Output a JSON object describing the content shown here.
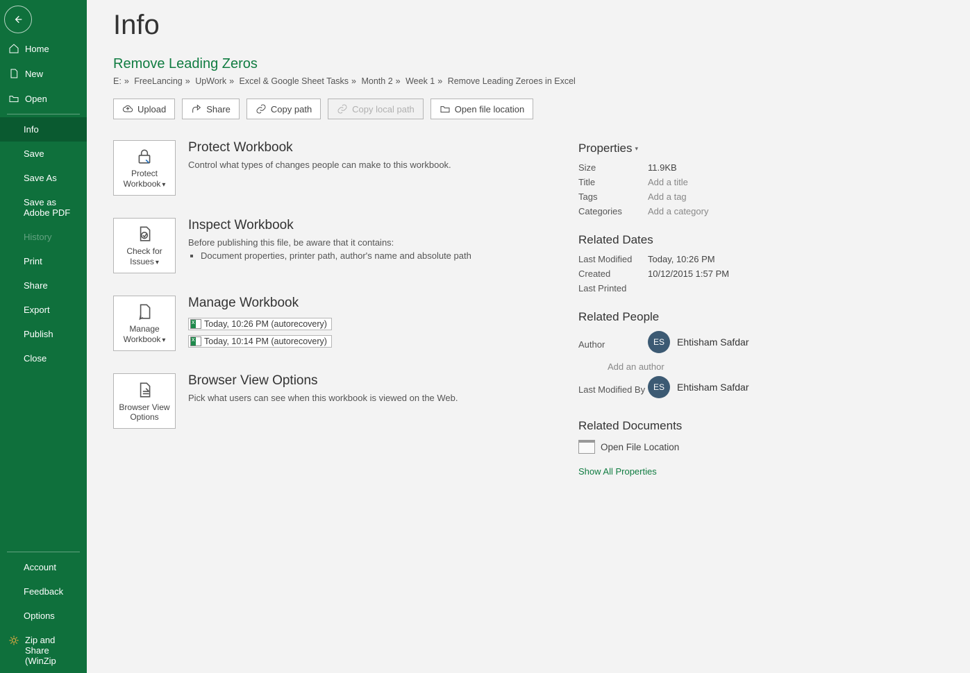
{
  "page": {
    "title": "Info"
  },
  "document": {
    "title": "Remove Leading Zeros"
  },
  "breadcrumb": {
    "parts": [
      "E:",
      "FreeLancing",
      "UpWork",
      "Excel & Google Sheet Tasks",
      "Month 2",
      "Week 1",
      "Remove Leading Zeroes in Excel"
    ],
    "sep": "»"
  },
  "sidebar": {
    "top": [
      {
        "key": "home",
        "label": "Home"
      },
      {
        "key": "new",
        "label": "New"
      },
      {
        "key": "open",
        "label": "Open"
      }
    ],
    "mid": [
      {
        "key": "info",
        "label": "Info",
        "selected": true
      },
      {
        "key": "save",
        "label": "Save"
      },
      {
        "key": "saveas",
        "label": "Save As"
      },
      {
        "key": "savepdf",
        "label": "Save as Adobe PDF"
      },
      {
        "key": "history",
        "label": "History",
        "disabled": true
      },
      {
        "key": "print",
        "label": "Print"
      },
      {
        "key": "share",
        "label": "Share"
      },
      {
        "key": "export",
        "label": "Export"
      },
      {
        "key": "publish",
        "label": "Publish"
      },
      {
        "key": "close",
        "label": "Close"
      }
    ],
    "bottom": [
      {
        "key": "account",
        "label": "Account"
      },
      {
        "key": "feedback",
        "label": "Feedback"
      },
      {
        "key": "options",
        "label": "Options"
      },
      {
        "key": "zip",
        "label": "Zip and Share (WinZip"
      }
    ]
  },
  "actions": {
    "upload": "Upload",
    "share": "Share",
    "copypath": "Copy path",
    "copylocal": "Copy local path",
    "openloc": "Open file location"
  },
  "blocks": {
    "protect": {
      "btn": "Protect Workbook",
      "title": "Protect Workbook",
      "desc": "Control what types of changes people can make to this workbook."
    },
    "inspect": {
      "btn": "Check for Issues",
      "title": "Inspect Workbook",
      "desc": "Before publishing this file, be aware that it contains:",
      "items": [
        "Document properties, printer path, author's name and absolute path"
      ]
    },
    "manage": {
      "btn": "Manage Workbook",
      "title": "Manage Workbook",
      "versions": [
        "Today, 10:26 PM (autorecovery)",
        "Today, 10:14 PM (autorecovery)"
      ]
    },
    "browser": {
      "btn": "Browser View Options",
      "title": "Browser View Options",
      "desc": "Pick what users can see when this workbook is viewed on the Web."
    }
  },
  "properties": {
    "heading": "Properties",
    "rows": {
      "size_label": "Size",
      "size_value": "11.9KB",
      "title_label": "Title",
      "title_value": "Add a title",
      "tags_label": "Tags",
      "tags_value": "Add a tag",
      "cat_label": "Categories",
      "cat_value": "Add a category"
    }
  },
  "dates": {
    "heading": "Related Dates",
    "rows": {
      "mod_label": "Last Modified",
      "mod_value": "Today, 10:26 PM",
      "created_label": "Created",
      "created_value": "10/12/2015 1:57 PM",
      "printed_label": "Last Printed",
      "printed_value": ""
    }
  },
  "people": {
    "heading": "Related People",
    "author_label": "Author",
    "author_initials": "ES",
    "author_name": "Ehtisham Safdar",
    "add_author": "Add an author",
    "modby_label": "Last Modified By",
    "modby_initials": "ES",
    "modby_name": "Ehtisham Safdar"
  },
  "docs": {
    "heading": "Related Documents",
    "open_loc": "Open File Location",
    "show_all": "Show All Properties"
  }
}
